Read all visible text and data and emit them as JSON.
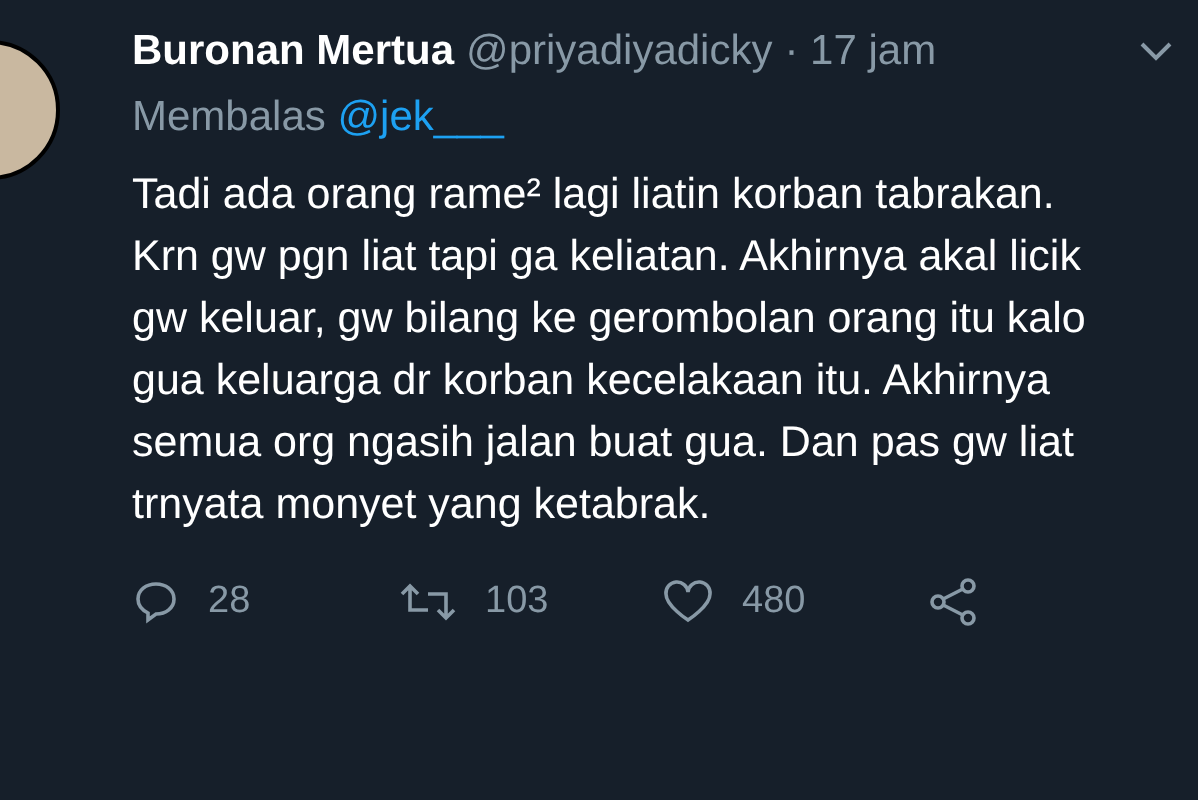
{
  "tweet": {
    "name": "Buronan Mertua",
    "handle": "@priyadiyadicky",
    "time": "· 17 jam",
    "reply_prefix": "Membalas",
    "reply_to": "@jek___",
    "text": "Tadi ada orang rame² lagi liatin korban tabrakan. Krn gw pgn liat tapi ga keliatan. Akhirnya akal licik gw keluar, gw bilang ke gerombolan orang itu kalo gua keluarga dr korban kecelakaan itu. Akhirnya semua org ngasih jalan buat gua. Dan pas gw liat trnyata monyet yang ketabrak.",
    "actions": [
      {
        "kind": "reply",
        "count": "28"
      },
      {
        "kind": "retweet",
        "count": "103"
      },
      {
        "kind": "like",
        "count": "480"
      },
      {
        "kind": "share"
      }
    ]
  }
}
